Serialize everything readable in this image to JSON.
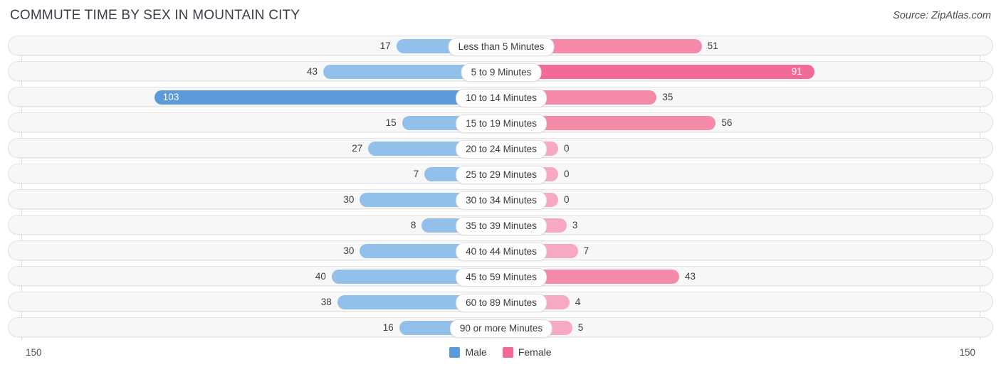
{
  "header": {
    "title": "COMMUTE TIME BY SEX IN MOUNTAIN CITY",
    "source": "Source: ZipAtlas.com"
  },
  "axis": {
    "left_label": "150",
    "right_label": "150"
  },
  "legend": {
    "items": [
      {
        "label": "Male",
        "color": "#5b9bd9"
      },
      {
        "label": "Female",
        "color": "#f2699a"
      }
    ]
  },
  "colors": {
    "male_light": "#92c0ea",
    "male_dark": "#5b9bd9",
    "female_light": "#f7a8c2",
    "female_mid": "#f589a8",
    "female_dark": "#f2699a",
    "track": "#f7f7f7",
    "track_border": "#e2e2e2"
  },
  "chart_data": {
    "type": "bar",
    "title": "COMMUTE TIME BY SEX IN MOUNTAIN CITY",
    "subtitle": "Source: ZipAtlas.com",
    "orientation": "horizontal-diverging",
    "xlabel": "",
    "ylabel": "",
    "xlim": [
      150,
      150
    ],
    "grid": false,
    "legend_position": "bottom-center",
    "categories": [
      "Less than 5 Minutes",
      "5 to 9 Minutes",
      "10 to 14 Minutes",
      "15 to 19 Minutes",
      "20 to 24 Minutes",
      "25 to 29 Minutes",
      "30 to 34 Minutes",
      "35 to 39 Minutes",
      "40 to 44 Minutes",
      "45 to 59 Minutes",
      "60 to 89 Minutes",
      "90 or more Minutes"
    ],
    "series": [
      {
        "name": "Male",
        "values": [
          17,
          43,
          103,
          15,
          27,
          7,
          30,
          8,
          30,
          40,
          38,
          16
        ]
      },
      {
        "name": "Female",
        "values": [
          51,
          91,
          35,
          56,
          0,
          0,
          0,
          3,
          7,
          43,
          4,
          5
        ]
      }
    ]
  },
  "rows": [
    {
      "category": "Less than 5 Minutes",
      "male": "17",
      "female": "51",
      "male_inside": false,
      "female_inside": false
    },
    {
      "category": "5 to 9 Minutes",
      "male": "43",
      "female": "91",
      "male_inside": false,
      "female_inside": true
    },
    {
      "category": "10 to 14 Minutes",
      "male": "103",
      "female": "35",
      "male_inside": true,
      "female_inside": false
    },
    {
      "category": "15 to 19 Minutes",
      "male": "15",
      "female": "56",
      "male_inside": false,
      "female_inside": false
    },
    {
      "category": "20 to 24 Minutes",
      "male": "27",
      "female": "0",
      "male_inside": false,
      "female_inside": false
    },
    {
      "category": "25 to 29 Minutes",
      "male": "7",
      "female": "0",
      "male_inside": false,
      "female_inside": false
    },
    {
      "category": "30 to 34 Minutes",
      "male": "30",
      "female": "0",
      "male_inside": false,
      "female_inside": false
    },
    {
      "category": "35 to 39 Minutes",
      "male": "8",
      "female": "3",
      "male_inside": false,
      "female_inside": false
    },
    {
      "category": "40 to 44 Minutes",
      "male": "30",
      "female": "7",
      "male_inside": false,
      "female_inside": false
    },
    {
      "category": "45 to 59 Minutes",
      "male": "40",
      "female": "43",
      "male_inside": false,
      "female_inside": false
    },
    {
      "category": "60 to 89 Minutes",
      "male": "38",
      "female": "4",
      "male_inside": false,
      "female_inside": false
    },
    {
      "category": "90 or more Minutes",
      "male": "16",
      "female": "5",
      "male_inside": false,
      "female_inside": false
    }
  ]
}
